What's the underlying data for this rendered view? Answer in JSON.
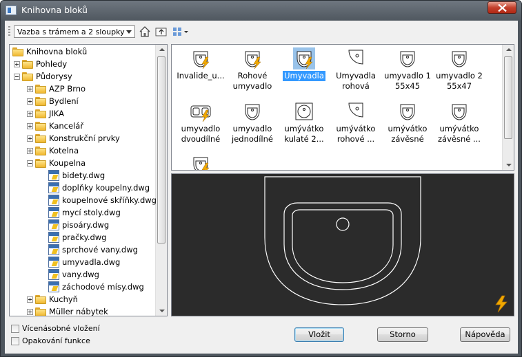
{
  "window": {
    "title": "Knihovna bloků"
  },
  "toolbar": {
    "combo_value": "Vazba s trámem a 2 sloupky",
    "icons": [
      "home-icon",
      "folder-up-icon",
      "view-mode-icon"
    ]
  },
  "tree": {
    "items": [
      {
        "label": "Knihovna bloků",
        "type": "folder",
        "level": 0,
        "expander": "none"
      },
      {
        "label": "Pohledy",
        "type": "folder",
        "level": 1,
        "expander": "plus"
      },
      {
        "label": "Půdorysy",
        "type": "folder",
        "level": 1,
        "expander": "minus"
      },
      {
        "label": "AZP Brno",
        "type": "folder",
        "level": 2,
        "expander": "plus"
      },
      {
        "label": "Bydlení",
        "type": "folder",
        "level": 2,
        "expander": "plus"
      },
      {
        "label": "JIKA",
        "type": "folder",
        "level": 2,
        "expander": "plus"
      },
      {
        "label": "Kancelář",
        "type": "folder",
        "level": 2,
        "expander": "plus"
      },
      {
        "label": "Konstrukční prvky",
        "type": "folder",
        "level": 2,
        "expander": "plus"
      },
      {
        "label": "Kotelna",
        "type": "folder",
        "level": 2,
        "expander": "plus"
      },
      {
        "label": "Koupelna",
        "type": "folder",
        "level": 2,
        "expander": "minus"
      },
      {
        "label": "bidety.dwg",
        "type": "file",
        "level": 3,
        "expander": "none"
      },
      {
        "label": "doplňky koupelny.dwg",
        "type": "file",
        "level": 3,
        "expander": "none"
      },
      {
        "label": "koupelnové skříňky.dwg",
        "type": "file",
        "level": 3,
        "expander": "none"
      },
      {
        "label": "mycí stoly.dwg",
        "type": "file",
        "level": 3,
        "expander": "none"
      },
      {
        "label": "pisoáry.dwg",
        "type": "file",
        "level": 3,
        "expander": "none"
      },
      {
        "label": "pračky.dwg",
        "type": "file",
        "level": 3,
        "expander": "none"
      },
      {
        "label": "sprchové vany.dwg",
        "type": "file",
        "level": 3,
        "expander": "none"
      },
      {
        "label": "umyvadla.dwg",
        "type": "file",
        "level": 3,
        "expander": "none"
      },
      {
        "label": "vany.dwg",
        "type": "file",
        "level": 3,
        "expander": "none"
      },
      {
        "label": "záchodové mísy.dwg",
        "type": "file",
        "level": 3,
        "expander": "none"
      },
      {
        "label": "Kuchyň",
        "type": "folder",
        "level": 2,
        "expander": "plus"
      },
      {
        "label": "Müller nábytek",
        "type": "folder",
        "level": 2,
        "expander": "plus"
      }
    ]
  },
  "gallery": {
    "items": [
      {
        "label": "Invalide_u...",
        "icon": "sink-wide-icon",
        "lightning": true,
        "selected": false
      },
      {
        "label": "Rohové umyvadlo",
        "icon": "corner-sink-small-icon",
        "lightning": true,
        "selected": false
      },
      {
        "label": "Umyvadla",
        "icon": "sink-selected-icon",
        "lightning": true,
        "selected": true
      },
      {
        "label": "Umyvadla rohová",
        "icon": "corner-sink-icon",
        "lightning": false,
        "selected": false
      },
      {
        "label": "umyvadlo 1 55x45",
        "icon": "sink-round-icon",
        "lightning": false,
        "selected": false
      },
      {
        "label": "umyvadlo 2 55x47",
        "icon": "sink-square-icon",
        "lightning": false,
        "selected": false
      },
      {
        "label": "umyvadlo dvoudílné",
        "icon": "double-sink-icon",
        "lightning": true,
        "selected": false
      },
      {
        "label": "umyvadlo jednodílné",
        "icon": "single-sink-icon",
        "lightning": false,
        "selected": false
      },
      {
        "label": "umývátko kulaté 2...",
        "icon": "round-basin-icon",
        "lightning": false,
        "selected": false
      },
      {
        "label": "umývátko rohové ...",
        "icon": "corner-basin-icon",
        "lightning": false,
        "selected": false
      },
      {
        "label": "umývátko závěsné",
        "icon": "hanging-basin-icon",
        "lightning": false,
        "selected": false
      },
      {
        "label": "umývátko závěsné ...",
        "icon": "hanging-basin-2-icon",
        "lightning": false,
        "selected": false
      },
      {
        "label": "",
        "icon": "sink-partial-icon",
        "lightning": true,
        "selected": false
      }
    ]
  },
  "options": {
    "multiple_insert": "Vícenásobné vložení",
    "repeat_function": "Opakování funkce"
  },
  "buttons": {
    "insert": "Vložit",
    "cancel": "Storno",
    "help": "Nápověda"
  },
  "colors": {
    "preview_bg": "#2b2b2b",
    "preview_stroke": "#ffffff",
    "selection": "#3399ff",
    "lightning": "#f0a800"
  }
}
